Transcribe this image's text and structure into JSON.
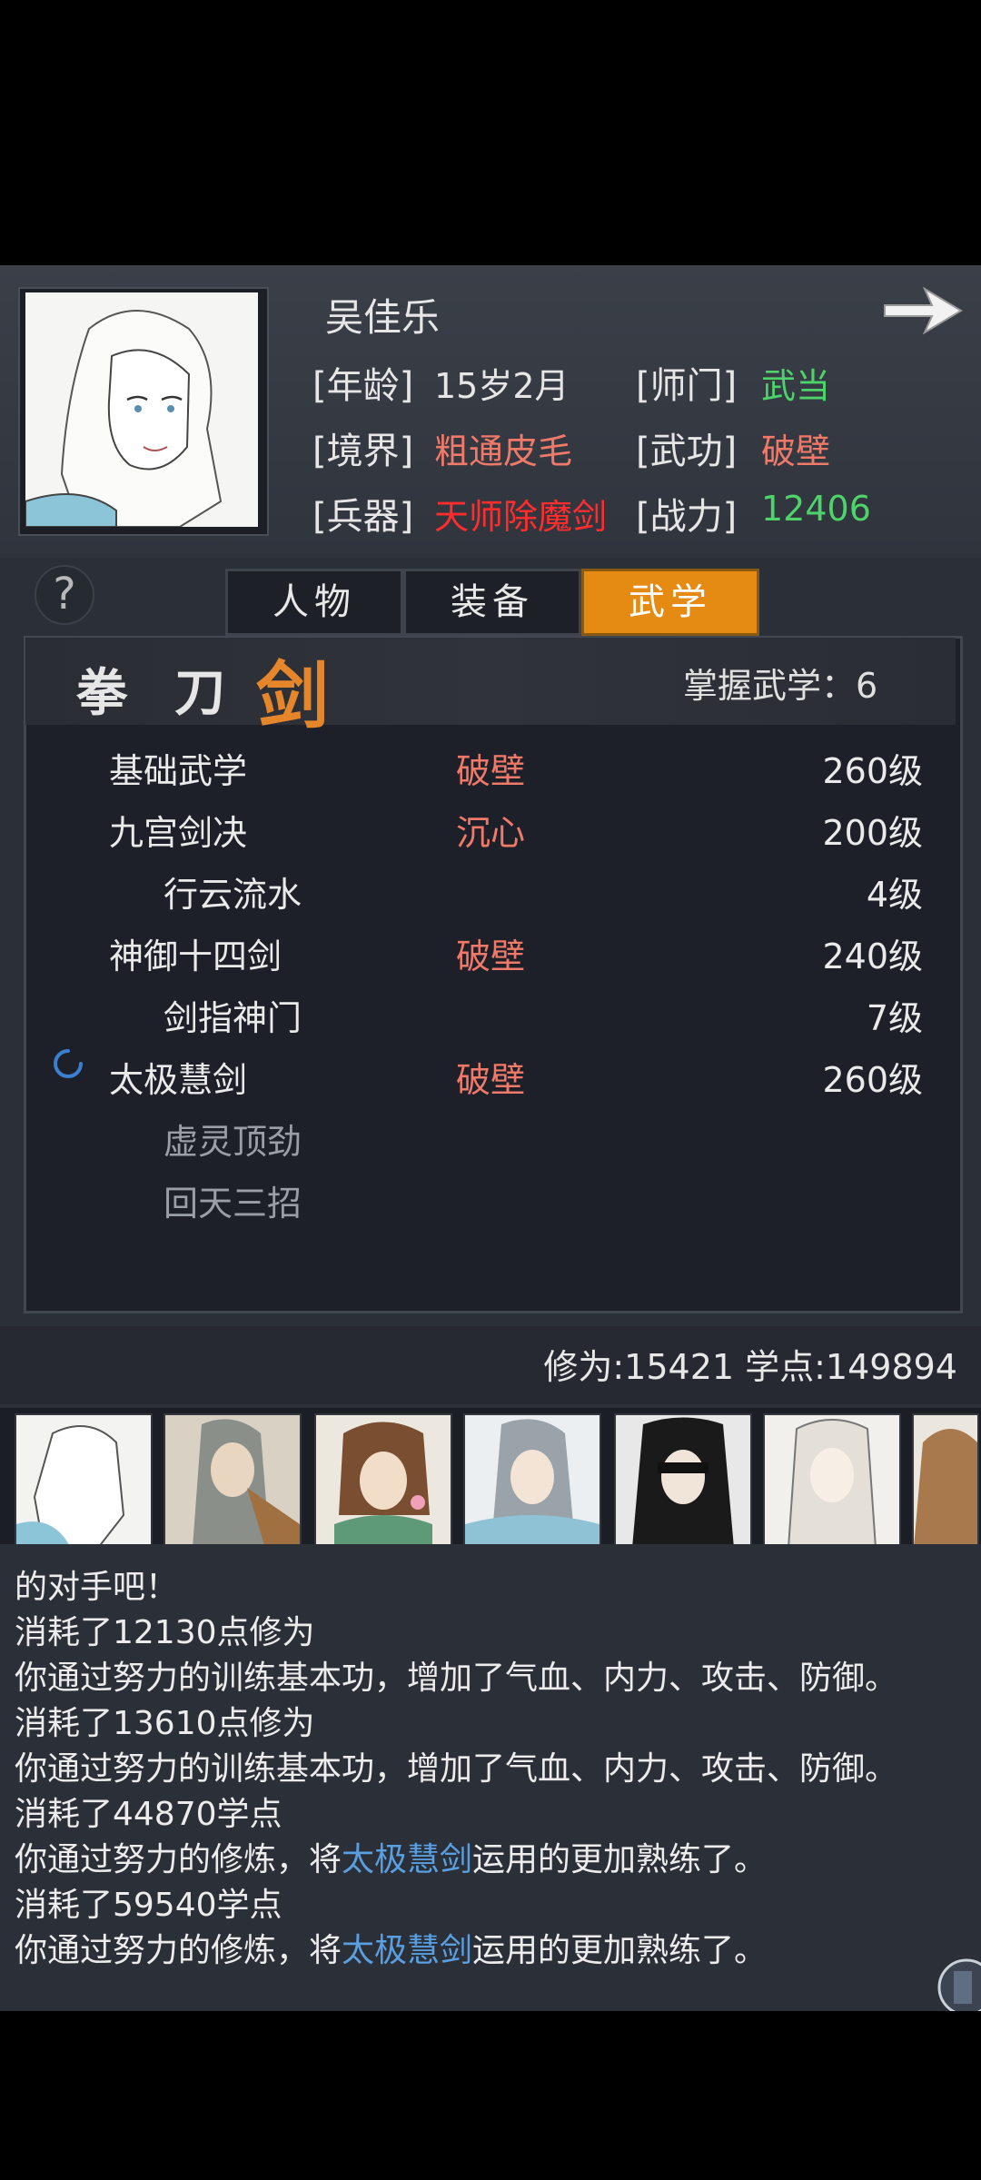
{
  "character": {
    "name": "吴佳乐",
    "age_label": "[年龄]",
    "age": "15岁2月",
    "sect_label": "[师门]",
    "sect": "武当",
    "realm_label": "[境界]",
    "realm": "粗通皮毛",
    "skill_label": "[武功]",
    "skill": "破壁",
    "weapon_label": "[兵器]",
    "weapon": "天师除魔剑",
    "power_label": "[战力]",
    "power": "12406"
  },
  "tabs": [
    {
      "label": "人物",
      "active": false
    },
    {
      "label": "装备",
      "active": false
    },
    {
      "label": "武学",
      "active": true
    }
  ],
  "help_icon": "?",
  "categories": [
    {
      "label": "拳",
      "active": false
    },
    {
      "label": "刀",
      "active": false
    },
    {
      "label": "剑",
      "active": true
    }
  ],
  "mastered_label": "掌握武学：6",
  "skills": [
    {
      "name": "基础武学",
      "rank": "破壁",
      "level": "260级",
      "indent": false
    },
    {
      "name": "九宫剑决",
      "rank": "沉心",
      "level": "200级",
      "indent": false
    },
    {
      "name": "行云流水",
      "rank": "",
      "level": "4级",
      "indent": true
    },
    {
      "name": "神御十四剑",
      "rank": "破壁",
      "level": "240级",
      "indent": false
    },
    {
      "name": "剑指神门",
      "rank": "",
      "level": "7级",
      "indent": true
    },
    {
      "name": "太极慧剑",
      "rank": "破壁",
      "level": "260级",
      "indent": false
    },
    {
      "name": "虚灵顶劲",
      "rank": "",
      "level": "",
      "indent": true
    },
    {
      "name": "回天三招",
      "rank": "",
      "level": "",
      "indent": true
    }
  ],
  "points": "修为:15421  学点:149894",
  "log": [
    "的对手吧！",
    "消耗了12130点修为",
    "你通过努力的训练基本功，增加了气血、内力、攻击、防御。",
    "消耗了13610点修为",
    "你通过努力的训练基本功，增加了气血、内力、攻击、防御。",
    "消耗了44870学点",
    {
      "pre": "你通过努力的修炼，将",
      "hl": "太极慧剑",
      "post": "运用的更加熟练了。"
    },
    "消耗了59540学点",
    {
      "pre": "你通过努力的修炼，将",
      "hl": "太极慧剑",
      "post": "运用的更加熟练了。"
    }
  ],
  "colors": {
    "accent": "#e58a12",
    "rank": "#f07a6a",
    "green": "#4ed36a",
    "weapon": "#ff2d2d",
    "link": "#5a9fe0"
  },
  "icons": [
    "arrow-right-icon",
    "help-icon",
    "loading-spinner-icon"
  ]
}
